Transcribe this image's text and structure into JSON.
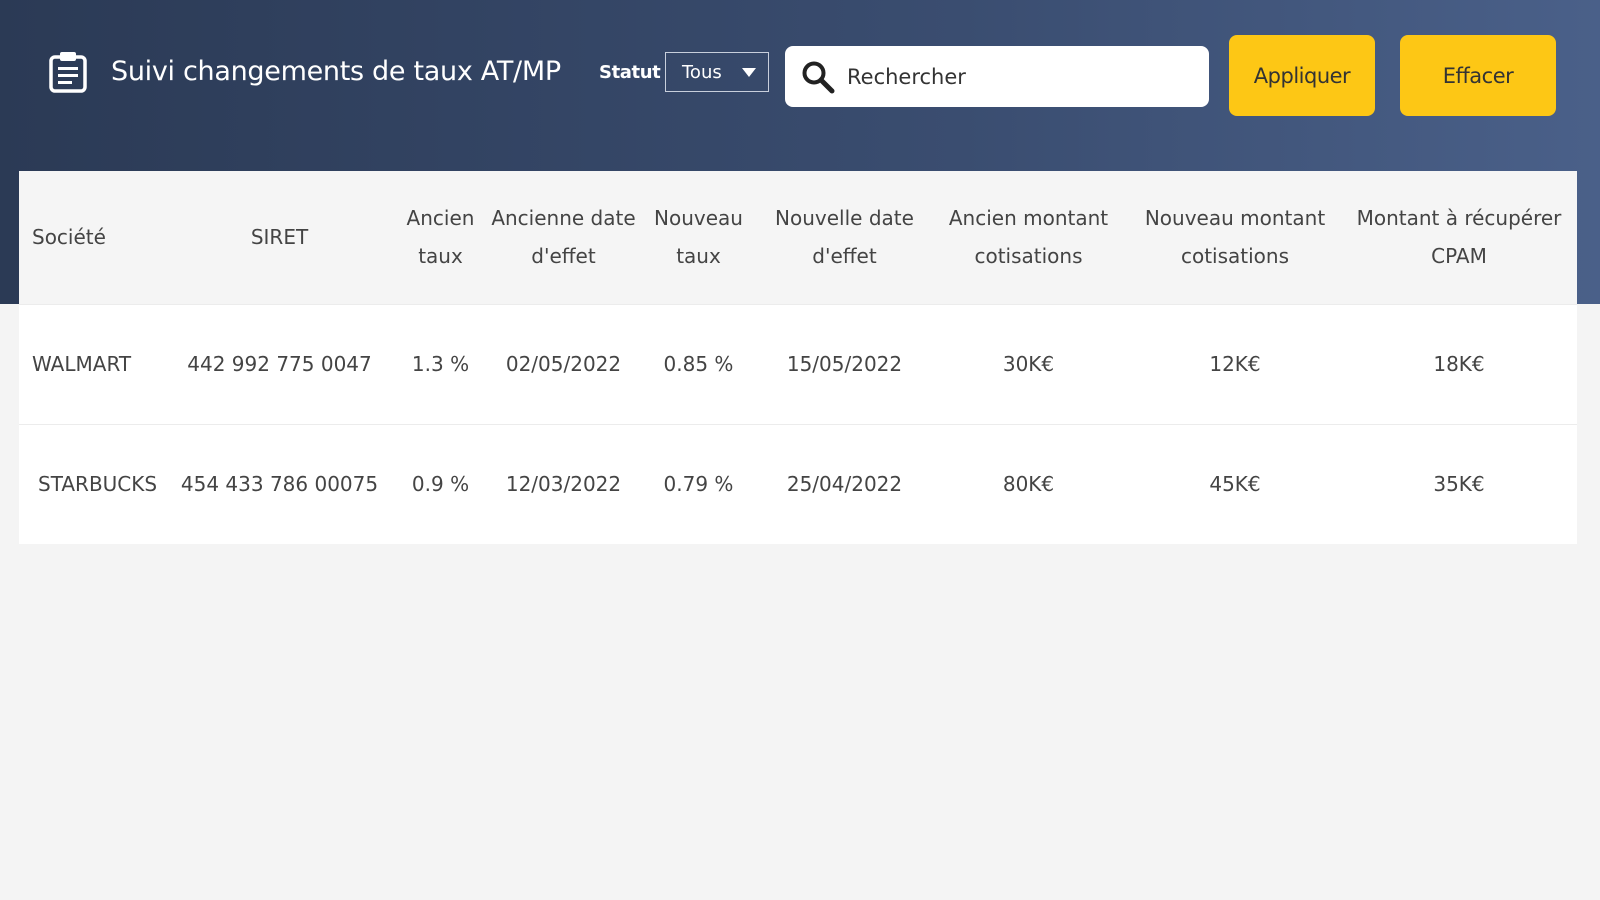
{
  "header": {
    "title": "Suivi changements de taux AT/MP",
    "app_icon": "clipboard-icon",
    "status_label": "Statut",
    "status_value": "Tous",
    "search_placeholder": "Rechercher",
    "apply_label": "Appliquer",
    "clear_label": "Effacer",
    "colors": {
      "accent": "#fdc715",
      "header_start": "#2b3a55",
      "header_end": "#4a6089"
    }
  },
  "table": {
    "columns": [
      "Société",
      "SIRET",
      "Ancien taux",
      "Ancienne date d'effet",
      "Nouveau taux",
      "Nouvelle date d'effet",
      "Ancien montant cotisations",
      "Nouveau montant cotisations",
      "Montant à récupérer CPAM"
    ],
    "rows": [
      [
        "WALMART",
        "442 992 775 0047",
        "1.3 %",
        "02/05/2022",
        "0.85 %",
        "15/05/2022",
        "30K€",
        "12K€",
        "18K€"
      ],
      [
        "STARBUCKS",
        "454 433 786 00075",
        "0.9 %",
        "12/03/2022",
        "0.79 %",
        "25/04/2022",
        "80K€",
        "45K€",
        "35K€"
      ]
    ]
  }
}
